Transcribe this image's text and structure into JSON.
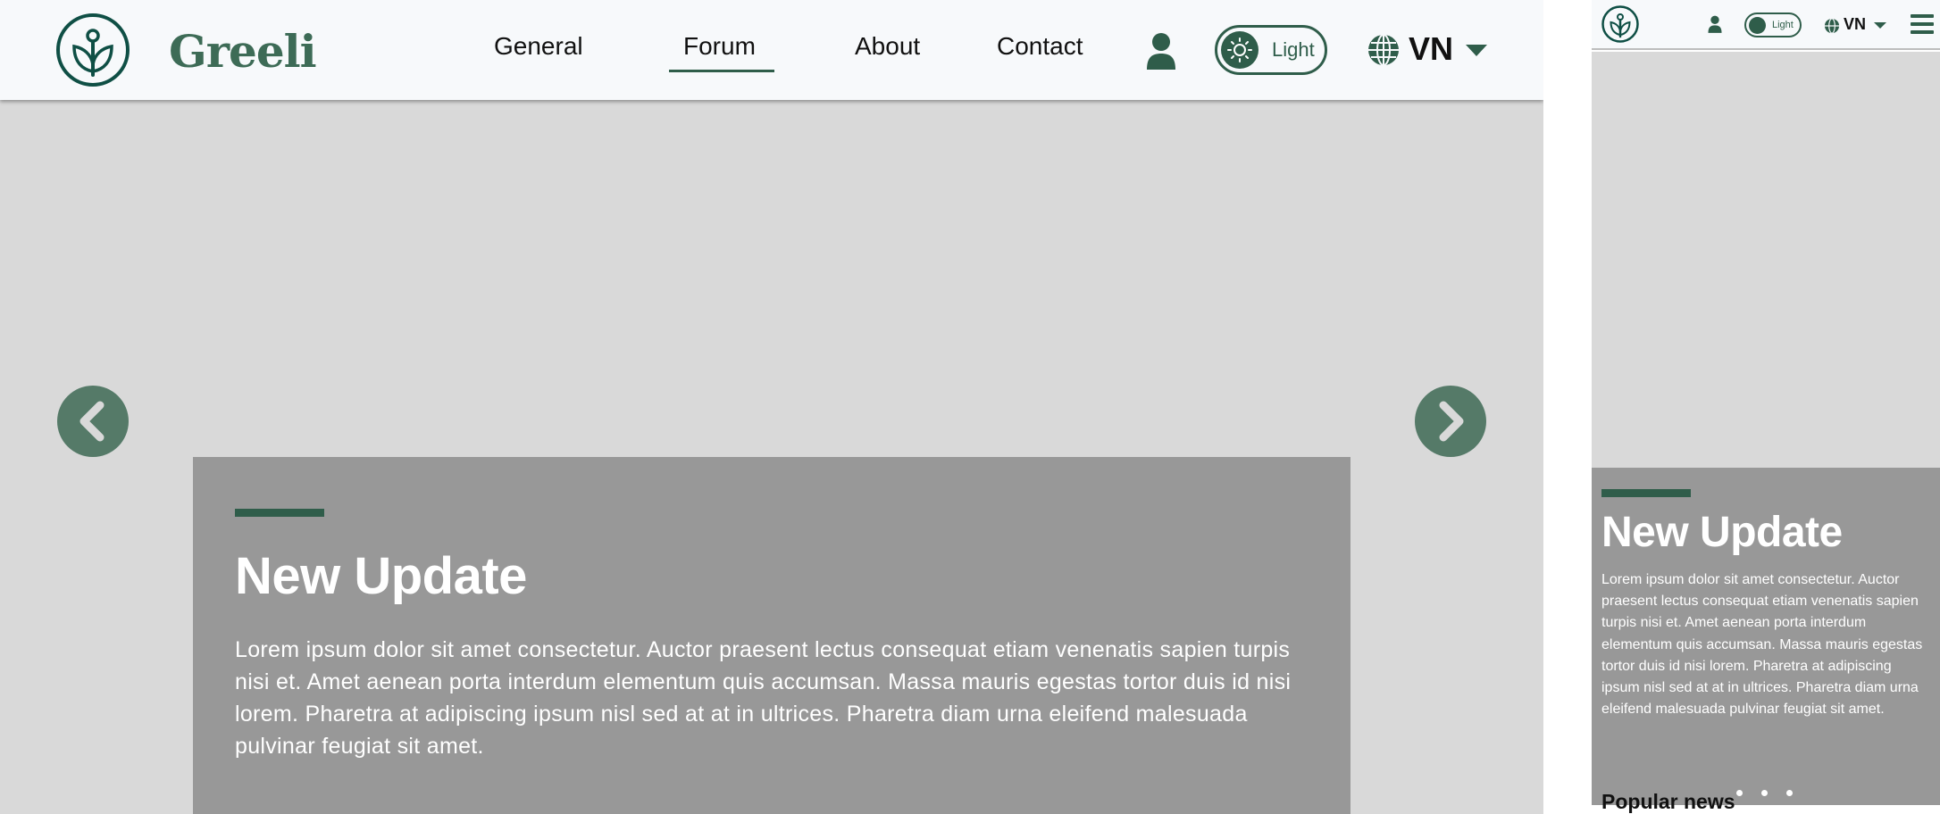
{
  "brand": {
    "name": "Greeli"
  },
  "nav": {
    "items": [
      {
        "label": "General"
      },
      {
        "label": "Forum",
        "active": true
      },
      {
        "label": "About"
      },
      {
        "label": "Contact"
      }
    ]
  },
  "theme_toggle": {
    "label": "Light",
    "icon": "sun-icon"
  },
  "language": {
    "selected": "VN",
    "icon": "globe-icon"
  },
  "carousel": {
    "prev_icon": "chevron-left-icon",
    "next_icon": "chevron-right-icon",
    "slide_count": 3,
    "active_slide": 1
  },
  "hero_card": {
    "title": "New Update",
    "body": "Lorem ipsum dolor sit amet consectetur. Auctor praesent lectus consequat etiam venenatis sapien turpis nisi et. Amet aenean porta interdum elementum quis accumsan. Massa mauris egestas tortor duis id nisi lorem. Pharetra at adipiscing ipsum nisl sed at at in ultrices. Pharetra diam urna eleifend malesuada pulvinar feugiat sit amet."
  },
  "mobile": {
    "menu_icon": "hamburger-menu-icon",
    "section_title": "Popular news"
  },
  "colors": {
    "accent": "#2f5d4a",
    "arrow_bg": "#557a68",
    "header_bg": "#f7f9fb",
    "hero_bg": "#d9d9d9",
    "card_bg": "#989898"
  }
}
